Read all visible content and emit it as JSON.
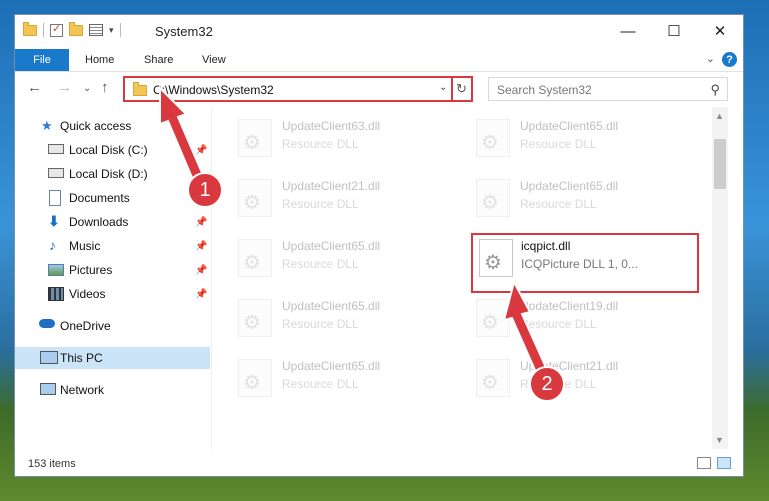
{
  "window": {
    "title": "System32",
    "minimize_glyph": "—",
    "maximize_glyph": "☐",
    "close_glyph": "✕"
  },
  "ribbon": {
    "tabs": [
      "File",
      "Home",
      "Share",
      "View"
    ]
  },
  "address": {
    "path": "C:\\Windows\\System32"
  },
  "search": {
    "placeholder": "Search System32"
  },
  "sidebar": {
    "items": [
      {
        "label": "Quick access",
        "icon": "star-icon",
        "pinned": false
      },
      {
        "label": "Local Disk (C:)",
        "icon": "drive-icon",
        "pinned": true
      },
      {
        "label": "Local Disk (D:)",
        "icon": "drive-icon",
        "pinned": false
      },
      {
        "label": "Documents",
        "icon": "documents-icon",
        "pinned": true
      },
      {
        "label": "Downloads",
        "icon": "download-icon",
        "pinned": true
      },
      {
        "label": "Music",
        "icon": "music-icon",
        "pinned": true
      },
      {
        "label": "Pictures",
        "icon": "pictures-icon",
        "pinned": true
      },
      {
        "label": "Videos",
        "icon": "videos-icon",
        "pinned": true
      },
      {
        "label": "OneDrive",
        "icon": "cloud-icon",
        "pinned": false
      },
      {
        "label": "This PC",
        "icon": "computer-icon",
        "pinned": false,
        "selected": true
      },
      {
        "label": "Network",
        "icon": "network-icon",
        "pinned": false
      }
    ]
  },
  "files": [
    {
      "name": "UpdateClient63.dll",
      "desc": "Resource DLL",
      "faded": true
    },
    {
      "name": "UpdateClient65.dll",
      "desc": "Resource DLL",
      "faded": true
    },
    {
      "name": "UpdateClient21.dll",
      "desc": "Resource DLL",
      "faded": true
    },
    {
      "name": "UpdateClient65.dll",
      "desc": "Resource DLL",
      "faded": true
    },
    {
      "name": "UpdateClient65.dll",
      "desc": "Resource DLL",
      "faded": true
    },
    {
      "name": "icqpict.dll",
      "desc": "ICQPicture DLL 1, 0...",
      "faded": false,
      "highlighted": true
    },
    {
      "name": "UpdateClient65.dll",
      "desc": "Resource DLL",
      "faded": true
    },
    {
      "name": "UpdateClient19.dll",
      "desc": "Resource DLL",
      "faded": true
    },
    {
      "name": "UpdateClient65.dll",
      "desc": "Resource DLL",
      "faded": true
    },
    {
      "name": "UpdateClient21.dll",
      "desc": "Resource DLL",
      "faded": true
    }
  ],
  "status": {
    "items_count": "153 items"
  },
  "annotations": {
    "marker_1": "1",
    "marker_2": "2",
    "color": "#d9393e"
  }
}
